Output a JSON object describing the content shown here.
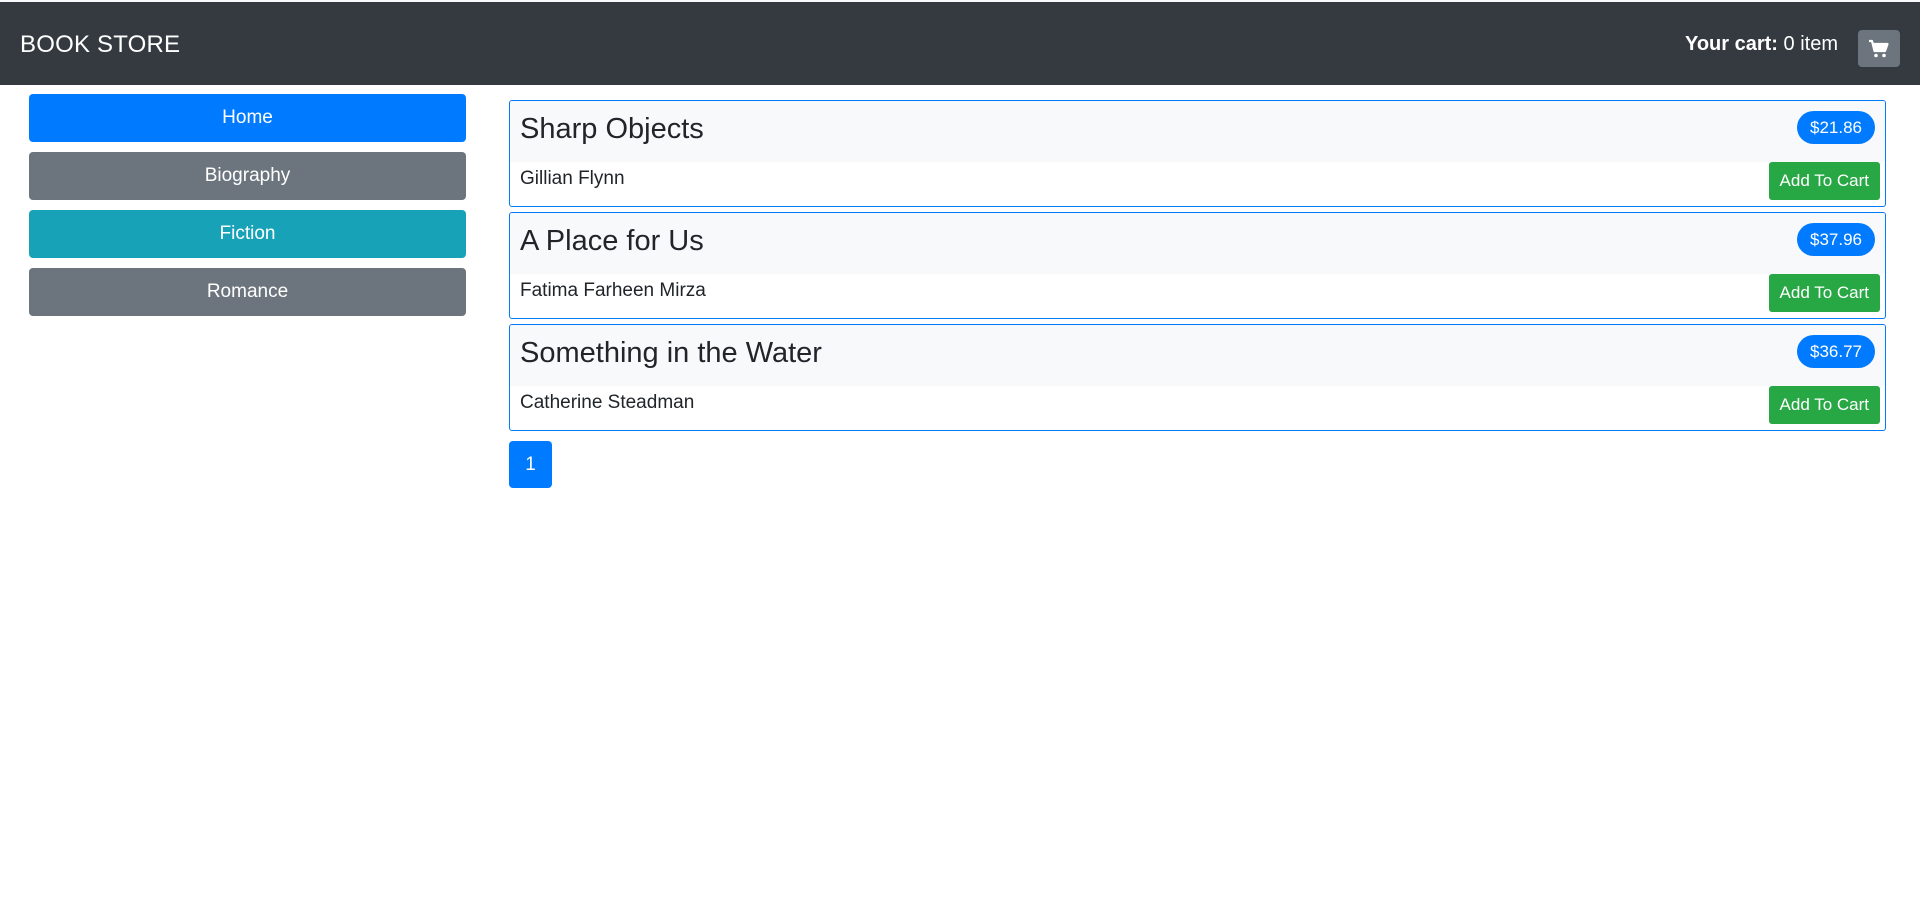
{
  "navbar": {
    "brand": "BOOK STORE",
    "cart_label": "Your cart:",
    "cart_count": "0 item",
    "cart_icon": "shopping-cart-icon"
  },
  "sidebar": {
    "items": [
      {
        "label": "Home",
        "color": "#007bff"
      },
      {
        "label": "Biography",
        "color": "#6c757d"
      },
      {
        "label": "Fiction",
        "color": "#17a2b8"
      },
      {
        "label": "Romance",
        "color": "#6c757d"
      }
    ]
  },
  "books": [
    {
      "title": "Sharp Objects",
      "author": "Gillian Flynn",
      "price": "$21.86",
      "action": "Add To Cart"
    },
    {
      "title": "A Place for Us",
      "author": "Fatima Farheen Mirza",
      "price": "$37.96",
      "action": "Add To Cart"
    },
    {
      "title": "Something in the Water",
      "author": "Catherine Steadman",
      "price": "$36.77",
      "action": "Add To Cart"
    }
  ],
  "pagination": {
    "pages": [
      "1"
    ]
  },
  "colors": {
    "navbar_bg": "#343a40",
    "primary": "#007bff",
    "secondary": "#6c757d",
    "info": "#17a2b8",
    "success": "#28a745"
  }
}
